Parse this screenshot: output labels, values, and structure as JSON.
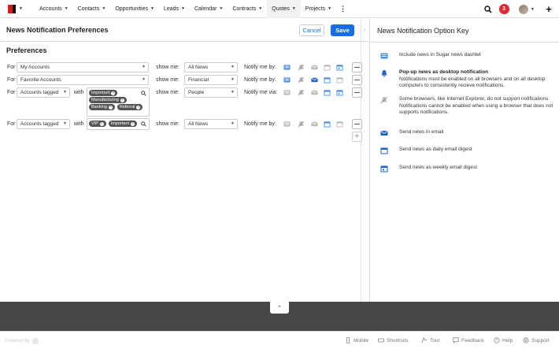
{
  "nav": {
    "items": [
      {
        "label": "Accounts"
      },
      {
        "label": "Contacts"
      },
      {
        "label": "Opportunities"
      },
      {
        "label": "Leads"
      },
      {
        "label": "Calendar"
      },
      {
        "label": "Contracts"
      },
      {
        "label": "Quotes"
      },
      {
        "label": "Projects"
      }
    ],
    "notification_count": "3"
  },
  "header": {
    "title": "News Notification Preferences",
    "cancel_label": "Cancel",
    "save_label": "Save"
  },
  "preferences": {
    "title": "Preferences",
    "for_label": "For",
    "with_label": "with",
    "show_me_label": "show me:",
    "rows": [
      {
        "for_value": "My Accounts",
        "show_value": "All News",
        "notify_label": "Notify me by:",
        "tags": []
      },
      {
        "for_value": "Favorite Accounts",
        "show_value": "Financial",
        "notify_label": "Notify me by:",
        "tags": []
      },
      {
        "for_value": "Accounts tagged",
        "show_value": "People",
        "notify_label": "Notify me via:",
        "tags": [
          "Important",
          "Manufacturing",
          "Banking",
          "Referral"
        ]
      },
      {
        "for_value": "Accounts tagged",
        "show_value": "All News",
        "notify_label": "Notify me by:",
        "tags": [
          "VIP",
          "Important"
        ]
      }
    ]
  },
  "key_panel": {
    "title": "News Notification Option Key",
    "items": [
      {
        "icon": "dashlet-icon",
        "title": "Include news in Sugar news dashlet",
        "desc": ""
      },
      {
        "icon": "bell-icon",
        "title": "Pop-up news as desktop notification",
        "desc": "Notifications must be enabled on all browsers and on all desktop computers to consistently recieve notifications."
      },
      {
        "icon": "bell-off-icon",
        "title": "",
        "desc": "Some browsers, like Internet Explorer, do not support notifications. Notifications cannot be enabled when using a browser that does not supports notifications."
      },
      {
        "icon": "email-icon",
        "title": "Send news in email",
        "desc": ""
      },
      {
        "icon": "calendar-daily-icon",
        "title": "Send news as daily email digest",
        "desc": ""
      },
      {
        "icon": "calendar-weekly-icon",
        "title": "Send news as weekly email digest",
        "desc": ""
      }
    ]
  },
  "footer": {
    "powered_by": "Powered by",
    "links": [
      {
        "label": "Mobile"
      },
      {
        "label": "Shortcuts"
      },
      {
        "label": "Tour"
      },
      {
        "label": "Feedback"
      },
      {
        "label": "Help"
      },
      {
        "label": "Support"
      }
    ]
  },
  "colors": {
    "accent": "#176de5",
    "badge": "#e0262f",
    "footer_dark": "#474747"
  }
}
